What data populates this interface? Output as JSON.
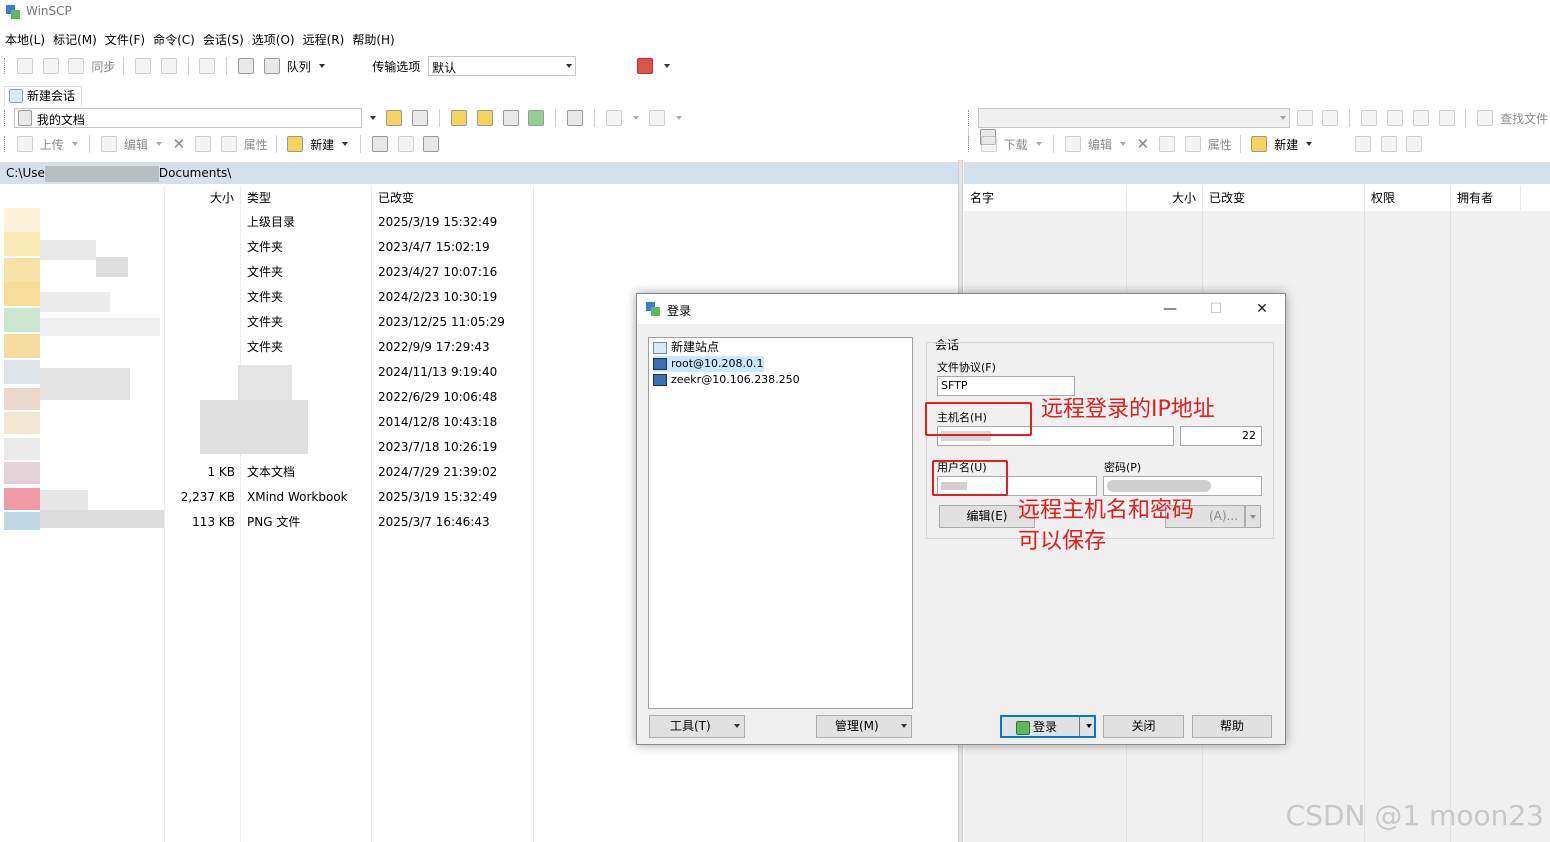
{
  "window": {
    "title": "WinSCP"
  },
  "menu": [
    "本地(L)",
    "标记(M)",
    "文件(F)",
    "命令(C)",
    "会话(S)",
    "选项(O)",
    "远程(R)",
    "帮助(H)"
  ],
  "toolbar": {
    "sync_label": "同步",
    "queue_label": "队列",
    "transfer_options_label": "传输选项",
    "transfer_options_value": "默认"
  },
  "session_tab": {
    "label": "新建会话"
  },
  "local": {
    "location": "我的文档",
    "actions": {
      "upload": "上传",
      "edit": "编辑",
      "properties": "属性",
      "new": "新建"
    },
    "path_prefix": "C:\\Use",
    "path_suffix": "Documents\\",
    "columns": {
      "size": "大小",
      "type": "类型",
      "modified": "已改变"
    },
    "rows": [
      {
        "size": "",
        "type": "上级目录",
        "modified": "2025/3/19  15:32:49"
      },
      {
        "size": "",
        "type": "文件夹",
        "modified": "2023/4/7  15:02:19"
      },
      {
        "size": "",
        "type": "文件夹",
        "modified": "2023/4/27  10:07:16"
      },
      {
        "size": "",
        "type": "文件夹",
        "modified": "2024/2/23  10:30:19"
      },
      {
        "size": "",
        "type": "文件夹",
        "modified": "2023/12/25  11:05:29"
      },
      {
        "size": "",
        "type": "文件夹",
        "modified": "2022/9/9  17:29:43"
      },
      {
        "size": "",
        "type": "",
        "modified": "2024/11/13  9:19:40"
      },
      {
        "size": "",
        "type": "",
        "modified": "2022/6/29  10:06:48"
      },
      {
        "size": "",
        "type": "",
        "modified": "2014/12/8  10:43:18"
      },
      {
        "size": "",
        "type": "",
        "modified": "2023/7/18  10:26:19"
      },
      {
        "size": "1 KB",
        "type": "文本文档",
        "modified": "2024/7/29  21:39:02"
      },
      {
        "size": "2,237 KB",
        "type": "XMind Workbook",
        "modified": "2025/3/19  15:32:49"
      },
      {
        "size": "113 KB",
        "type": "PNG 文件",
        "modified": "2025/3/7  16:46:43"
      }
    ]
  },
  "remote": {
    "actions": {
      "download": "下载",
      "edit": "编辑",
      "properties": "属性",
      "new": "新建",
      "find": "查找文件"
    },
    "columns": {
      "name": "名字",
      "size": "大小",
      "modified": "已改变",
      "rights": "权限",
      "owner": "拥有者"
    }
  },
  "login_dialog": {
    "title": "登录",
    "sites": [
      "新建站点",
      "root@10.208.0.1",
      "zeekr@10.106.238.250"
    ],
    "session_group": "会话",
    "protocol_label": "文件协议(F)",
    "protocol_value": "SFTP",
    "host_label": "主机名(H)",
    "port_value": "22",
    "user_label": "用户名(U)",
    "password_label": "密码(P)",
    "edit_button": "编辑(E)",
    "advanced_partial": "(A)...",
    "tools_button": "工具(T)",
    "manage_button": "管理(M)",
    "login_button": "登录",
    "close_button": "关闭",
    "help_button": "帮助"
  },
  "annotations": {
    "ip": "远程登录的IP地址",
    "cred_line1": "远程主机名和密码",
    "cred_line2": "可以保存",
    "color": "#e02020"
  },
  "watermark": "CSDN @1 moon23"
}
